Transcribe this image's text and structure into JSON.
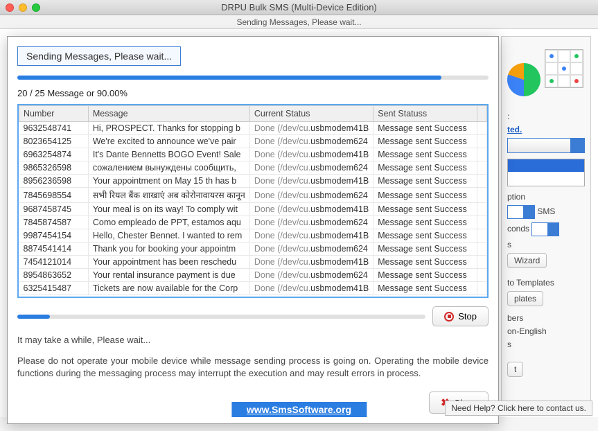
{
  "window": {
    "title": "DRPU Bulk SMS (Multi-Device Edition)",
    "subtitle": "Sending Messages, Please wait..."
  },
  "dialog": {
    "status": "Sending Messages, Please wait...",
    "progress_pct": 90,
    "counter": "20 / 25 Message or 90.00%",
    "columns": {
      "number": "Number",
      "message": "Message",
      "status": "Current Status",
      "sent": "Sent Statuss"
    },
    "rows": [
      {
        "number": "9632548741",
        "message": "Hi, PROSPECT. Thanks for stopping b",
        "status1": "Done (/dev/cu.",
        "status2": "usbmodem41B",
        "sent": "Message sent Success"
      },
      {
        "number": "8023654125",
        "message": "We're excited to announce we've pair",
        "status1": "Done (/dev/cu.",
        "status2": "usbmodem624",
        "sent": "Message sent Success"
      },
      {
        "number": "6963254874",
        "message": "It's Dante Bennetts BOGO Event! Sale",
        "status1": "Done (/dev/cu.",
        "status2": "usbmodem41B",
        "sent": "Message sent Success"
      },
      {
        "number": "9865326598",
        "message": "сожалением вынуждены сообщить,",
        "status1": "Done (/dev/cu.",
        "status2": "usbmodem624",
        "sent": "Message sent Success"
      },
      {
        "number": "8956236598",
        "message": "Your appointment on May 15 th has b",
        "status1": "Done (/dev/cu.",
        "status2": "usbmodem41B",
        "sent": "Message sent Success"
      },
      {
        "number": "7845698554",
        "message": "सभी रियल बैंक शाखाएं अब कोरोनावायरस कानून",
        "status1": "Done (/dev/cu.",
        "status2": "usbmodem624",
        "sent": "Message sent Success"
      },
      {
        "number": "9687458745",
        "message": "Your meal is on its way! To comply wit",
        "status1": "Done (/dev/cu.",
        "status2": "usbmodem41B",
        "sent": "Message sent Success"
      },
      {
        "number": "7845874587",
        "message": "Como empleado de PPT, estamos aqu",
        "status1": "Done (/dev/cu.",
        "status2": "usbmodem624",
        "sent": "Message sent Success"
      },
      {
        "number": "9987454154",
        "message": "Hello, Chester Bennet. I wanted to rem",
        "status1": "Done (/dev/cu.",
        "status2": "usbmodem41B",
        "sent": "Message sent Success"
      },
      {
        "number": "8874541414",
        "message": "Thank you for booking your appointm",
        "status1": "Done (/dev/cu.",
        "status2": "usbmodem624",
        "sent": "Message sent Success"
      },
      {
        "number": "7454121014",
        "message": "Your appointment has been reschedu",
        "status1": "Done (/dev/cu.",
        "status2": "usbmodem41B",
        "sent": "Message sent Success"
      },
      {
        "number": "8954863652",
        "message": "Your rental insurance payment is due",
        "status1": "Done (/dev/cu.",
        "status2": "usbmodem624",
        "sent": "Message sent Success"
      },
      {
        "number": "6325415487",
        "message": "Tickets are now available for the Corp",
        "status1": "Done (/dev/cu.",
        "status2": "usbmodem41B",
        "sent": "Message sent Success"
      }
    ],
    "stop": "Stop",
    "wait": "It may take a while, Please wait...",
    "warning": "Please do not operate your mobile device while message sending process is going on. Operating the mobile device functions during the messaging process may interrupt the execution and may result errors in process.",
    "close": "Close"
  },
  "sidebar": {
    "linked": "ted.",
    "option": "ption",
    "sms": "SMS",
    "seconds": "conds",
    "wizard": "Wizard",
    "to_templates": "to Templates",
    "plates": "plates",
    "bers": "bers",
    "non_english": "on-English",
    "s": "s",
    "t": "t"
  },
  "footer": {
    "url": "www.SmsSoftware.org",
    "help": "Need Help? Click here to contact us."
  }
}
